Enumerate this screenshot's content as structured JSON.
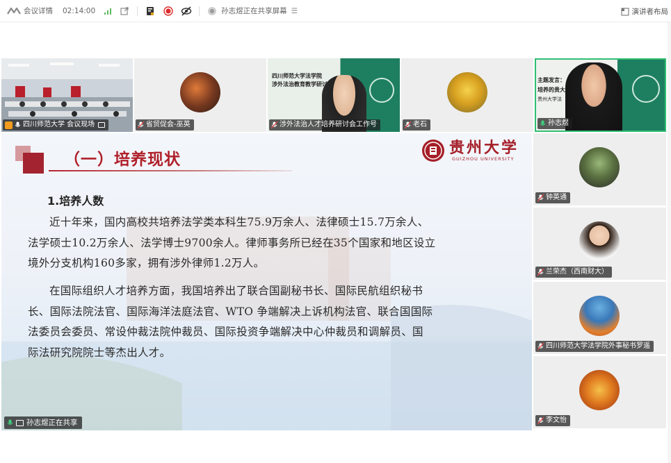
{
  "topbar": {
    "meeting_details": "会议详情",
    "timer": "02:14:00",
    "sharing_status": "孙志煜正在共享屏幕",
    "presenter_layout": "演讲者布局"
  },
  "gallery": [
    {
      "name": "四川师范大学 会议现场"
    },
    {
      "name": "省贸促会-巫英"
    },
    {
      "name": "涉外法治人才培养研讨会工作号",
      "banner_line1": "四川师范大学法学院",
      "banner_line2": "涉外法治教育教学研讨会"
    },
    {
      "name": "老石"
    },
    {
      "name": "孙志煜",
      "banner_line1": "主题发言：",
      "banner_line2": "培养的贵大",
      "banner_line3": "贵州大学法"
    }
  ],
  "slide": {
    "section_title": "（一）培养现状",
    "logo_cn": "贵州大学",
    "logo_en": "GUIZHOU UNIVERSITY",
    "heading": "1.培养人数",
    "para1_lines": [
      "近十年来，国内高校共培养法学类本科生75.9万余人、法律硕士15.7万余人、",
      "法学硕士10.2万余人、法学博士9700余人。律师事务所已经在35个国家和地区设立",
      "境外分支机构160多家，拥有涉外律师1.2万人。"
    ],
    "para2_lines": [
      "在国际组织人才培养方面，我国培养出了联合国副秘书长、国际民航组织秘书",
      "长、国际法院法官、国际海洋法庭法官、WTO 争端解决上诉机构法官、联合国国际",
      "法委员会委员、常设仲裁法院仲裁员、国际投资争端解决中心仲裁员和调解员、国",
      "际法研究院院士等杰出人才。"
    ],
    "sharing_label": "孙志煜正在共享"
  },
  "side": [
    {
      "name": "钟英通"
    },
    {
      "name": "兰荣杰（西南财大）"
    },
    {
      "name": "四川师范大学法学院外事秘书罗遥"
    },
    {
      "name": "李文怡"
    }
  ],
  "colors": {
    "accent_red": "#b0202a",
    "active_border": "#2fbf71",
    "record_red": "#e02b2b"
  }
}
